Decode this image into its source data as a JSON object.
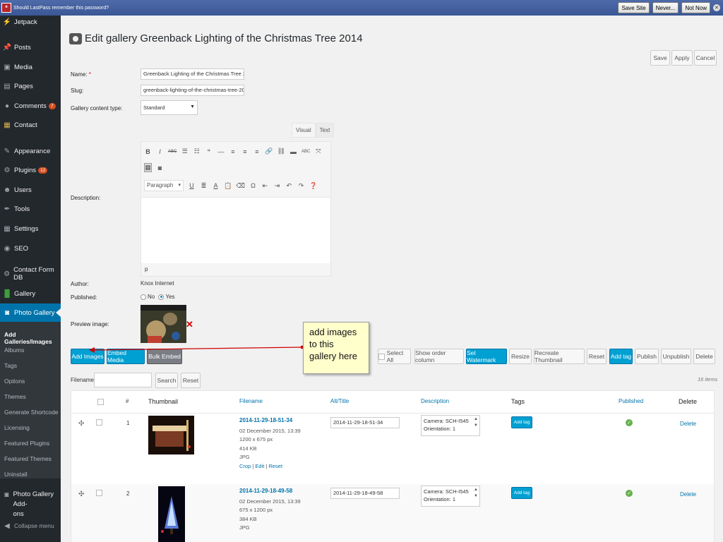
{
  "lastpass": {
    "message": "Should LastPass remember this password?",
    "save_site": "Save Site",
    "never": "Never...",
    "not_now": "Not Now"
  },
  "sidebar": {
    "items": [
      {
        "label": "Jetpack",
        "icon": "jetpack-icon"
      },
      {
        "label": "Posts",
        "icon": "pin-icon"
      },
      {
        "label": "Media",
        "icon": "media-icon"
      },
      {
        "label": "Pages",
        "icon": "pages-icon"
      },
      {
        "label": "Comments",
        "icon": "comments-icon",
        "badge": "7"
      },
      {
        "label": "Contact",
        "icon": "contact-icon"
      },
      {
        "label": "Appearance",
        "icon": "brush-icon"
      },
      {
        "label": "Plugins",
        "icon": "plugins-icon",
        "badge": "12"
      },
      {
        "label": "Users",
        "icon": "users-icon"
      },
      {
        "label": "Tools",
        "icon": "wrench-icon"
      },
      {
        "label": "Settings",
        "icon": "settings-icon"
      },
      {
        "label": "SEO",
        "icon": "seo-icon"
      },
      {
        "label": "Contact Form DB",
        "icon": "db-icon"
      },
      {
        "label": "Gallery",
        "icon": "gallery-icon"
      },
      {
        "label": "Photo Gallery",
        "icon": "camera-icon"
      }
    ],
    "submenu": [
      "Add Galleries/Images",
      "Albums",
      "Tags",
      "Options",
      "Themes",
      "Generate Shortcode",
      "Licensing",
      "Featured Plugins",
      "Featured Themes",
      "Uninstall"
    ],
    "addons": [
      "Photo Gallery Add-",
      "ons"
    ],
    "collapse": "Collapse menu"
  },
  "page": {
    "title": "Edit gallery Greenback Lighting of the Christmas Tree 2014",
    "save": "Save",
    "apply": "Apply",
    "cancel": "Cancel"
  },
  "form": {
    "name_label": "Name:",
    "name_required": "*",
    "name_value": "Greenback Lighting of the Christmas Tree 2014",
    "slug_label": "Slug:",
    "slug_value": "greenback-lighting-of-the-christmas-tree-2014",
    "type_label": "Gallery content type:",
    "type_value": "Standard",
    "description_label": "Description:",
    "author_label": "Author:",
    "author_value": "Knox Internet",
    "published_label": "Published:",
    "no": "No",
    "yes": "Yes",
    "preview_label": "Preview image:",
    "remove": "✕"
  },
  "editor": {
    "tab_visual": "Visual",
    "tab_text": "Text",
    "format": "Paragraph",
    "status": "p"
  },
  "actions": {
    "add_images": "Add Images",
    "embed_media": "Embed Media",
    "bulk_embed": "Bulk Embed",
    "select_all": "Select All",
    "show_order": "Show order column",
    "set_watermark": "Set Watermark",
    "resize": "Resize",
    "recreate_thumb": "Recreate Thumbnail",
    "reset": "Reset",
    "add_tag": "Add tag",
    "publish": "Publish",
    "unpublish": "Unpublish",
    "delete": "Delete"
  },
  "filter": {
    "label": "Filename:",
    "search": "Search",
    "reset": "Reset",
    "count": "16 items"
  },
  "callout": {
    "text": "add images to this gallery here"
  },
  "table": {
    "headers": {
      "order": "#",
      "thumbnail": "Thumbnail",
      "filename": "Filename",
      "alt": "Alt/Title",
      "description": "Description",
      "tags": "Tags",
      "published": "Published",
      "delete": "Delete"
    },
    "rows": [
      {
        "num": "1",
        "filename": "2014-11-29-18-51-34",
        "date": "02 December 2015, 13:39",
        "dims": "1200 x 675 px",
        "size": "414 KB",
        "type": "JPG",
        "crop": "Crop",
        "edit": "Edit",
        "reset": "Reset",
        "alt": "2014-11-29-18-51-34",
        "desc1": "Camera: SCH-I545",
        "desc2": "Orientation: 1",
        "add_tag": "Add tag",
        "delete": "Delete"
      },
      {
        "num": "2",
        "filename": "2014-11-29-18-49-58",
        "date": "02 December 2015, 13:39",
        "dims": "675 x 1200 px",
        "size": "384 KB",
        "type": "JPG",
        "alt": "2014-11-29-18-49-58",
        "desc1": "Camera: SCH-I545",
        "desc2": "Orientation: 1",
        "add_tag": "Add tag",
        "delete": "Delete"
      }
    ]
  },
  "colors": {
    "sidebar_bg": "#23282d",
    "active_blue": "#0073aa",
    "primary_button": "#00a0d2",
    "callout_bg": "#ffffcc",
    "annotation_red": "#d00000"
  }
}
